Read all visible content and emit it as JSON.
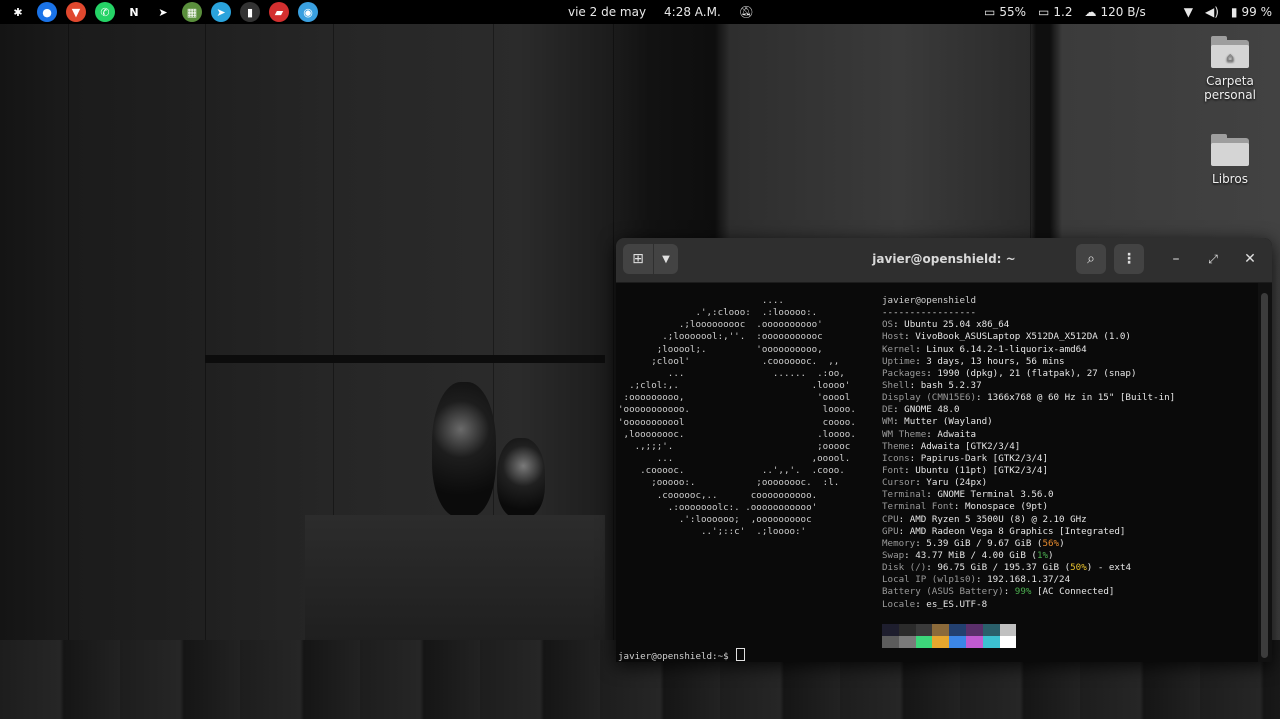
{
  "topbar": {
    "apps": [
      {
        "icon": "ubuntu-logo-icon",
        "glyph": "✱",
        "color": "#000000"
      },
      {
        "icon": "chrome-icon",
        "glyph": "●",
        "color": "#1a73e8"
      },
      {
        "icon": "brave-icon",
        "glyph": "▼",
        "color": "#e0482e"
      },
      {
        "icon": "whatsapp-icon",
        "glyph": "✆",
        "color": "#25d366"
      },
      {
        "icon": "notion-icon",
        "glyph": "N",
        "color": "#000000"
      },
      {
        "icon": "paper-plane-icon",
        "glyph": "➤",
        "color": "#000000"
      },
      {
        "icon": "software-store-icon",
        "glyph": "▦",
        "color": "#5a8f3c"
      },
      {
        "icon": "telegram-icon",
        "glyph": "➤",
        "color": "#2aa3dc"
      },
      {
        "icon": "terminal-icon",
        "glyph": "▮",
        "color": "#333333"
      },
      {
        "icon": "presentation-icon",
        "glyph": "▰",
        "color": "#d32f2f"
      },
      {
        "icon": "chat-bubble-icon",
        "glyph": "◉",
        "color": "#3aa0e0"
      }
    ],
    "date": "vie 2 de may",
    "time": "4:28 A.M.",
    "cpu": "55%",
    "load": "1.2",
    "net": "120 B/s",
    "battery": "99 %"
  },
  "desktop": {
    "icons": [
      {
        "label": "Carpeta personal",
        "icon": "home-folder-icon"
      },
      {
        "label": "Libros",
        "icon": "folder-icon"
      }
    ]
  },
  "terminal": {
    "title": "javier@openshield: ~",
    "ascii": [
      "                          ....",
      "              .',:clooo:  .:looooo:.",
      "           .;looooooooc  .oooooooooo'",
      "        .;looooool:,''.  :ooooooooooc",
      "       ;looool;.         'oooooooooo,",
      "      ;clool'             .cooooooc.  ,,",
      "         ...                ......  .:oo,",
      "  .;clol:,.                        .loooo'",
      " :ooooooooo,                        'ooool",
      "'ooooooooooo.                        loooo.",
      "'ooooooooool                         coooo.",
      " ,loooooooc.                        .loooo.",
      "   .,;;;'.                          ;ooooc",
      "       ...                         ,ooool.",
      "    .cooooc.              ..',,'.  .cooo.",
      "      ;ooooo:.           ;oooooooc.  :l.",
      "       .coooooc,..      coooooooooo.",
      "         .:ooooooolc:. .ooooooooooo'",
      "           .':loooooo;  ,oooooooooc",
      "               ..';::c'  .;loooo:'"
    ],
    "user": "javier",
    "host": "openshield",
    "separator": "-----------------",
    "info": [
      {
        "key": "OS",
        "value": "Ubuntu 25.04 x86_64"
      },
      {
        "key": "Host",
        "value": "VivoBook_ASUSLaptop X512DA_X512DA (1.0)"
      },
      {
        "key": "Kernel",
        "value": "Linux 6.14.2-1-liquorix-amd64"
      },
      {
        "key": "Uptime",
        "value": "3 days, 13 hours, 56 mins"
      },
      {
        "key": "Packages",
        "value": "1990 (dpkg), 21 (flatpak), 27 (snap)"
      },
      {
        "key": "Shell",
        "value": "bash 5.2.37"
      },
      {
        "key": "Display (CMN15E6)",
        "value": "1366x768 @ 60 Hz in 15\" [Built-in]"
      },
      {
        "key": "DE",
        "value": "GNOME 48.0"
      },
      {
        "key": "WM",
        "value": "Mutter (Wayland)"
      },
      {
        "key": "WM Theme",
        "value": "Adwaita"
      },
      {
        "key": "Theme",
        "value": "Adwaita [GTK2/3/4]"
      },
      {
        "key": "Icons",
        "value": "Papirus-Dark [GTK2/3/4]"
      },
      {
        "key": "Font",
        "value": "Ubuntu (11pt) [GTK2/3/4]"
      },
      {
        "key": "Cursor",
        "value": "Yaru (24px)"
      },
      {
        "key": "Terminal",
        "value": "GNOME Terminal 3.56.0"
      },
      {
        "key": "Terminal Font",
        "value": "Monospace (9pt)"
      },
      {
        "key": "CPU",
        "value": "AMD Ryzen 5 3500U (8) @ 2.10 GHz"
      },
      {
        "key": "GPU",
        "value": "AMD Radeon Vega 8 Graphics [Integrated]"
      },
      {
        "key": "Memory",
        "value": "5.39 GiB / 9.67 GiB",
        "pct": "56%",
        "pct_color": "#e68a2e"
      },
      {
        "key": "Swap",
        "value": "43.77 MiB / 4.00 GiB",
        "pct": "1%",
        "pct_color": "#4caf50"
      },
      {
        "key": "Disk (/)",
        "value": "96.75 GiB / 195.37 GiB",
        "pct": "50%",
        "pct_color": "#e6c02e",
        "suffix": " - ext4"
      },
      {
        "key": "Local IP (wlp1s0)",
        "value": "192.168.1.37/24"
      },
      {
        "key": "Battery (ASUS Battery)",
        "value": "",
        "pct": "99%",
        "pct_color": "#4caf50",
        "suffix": "[AC Connected]"
      },
      {
        "key": "Locale",
        "value": "es_ES.UTF-8"
      }
    ],
    "palette": {
      "normal": [
        "#1e1e2e",
        "#2b2b2b",
        "#3a3a3a",
        "#8b6a3a",
        "#23406f",
        "#5a2f6a",
        "#2a5f6a",
        "#c0c0c0"
      ],
      "bright": [
        "#5c5c5c",
        "#7a7a7a",
        "#3dd67a",
        "#e6a72e",
        "#3c86e6",
        "#c05ad0",
        "#3cc0d0",
        "#ffffff"
      ]
    },
    "prompt": "javier@openshield:~$ "
  }
}
